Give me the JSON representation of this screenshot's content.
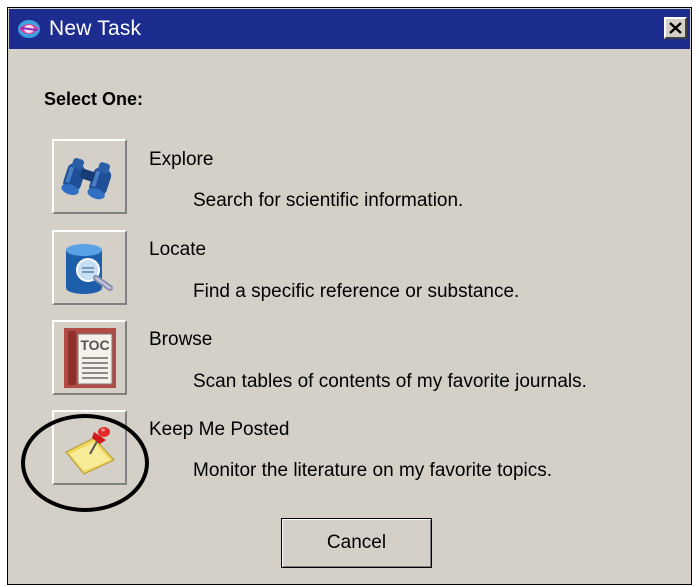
{
  "window": {
    "title": "New Task",
    "app_icon": "app-logo-icon",
    "close_icon": "close-icon",
    "title_bar_color": "#1d2d8f"
  },
  "heading": "Select One:",
  "tasks": [
    {
      "title": "Explore",
      "description": "Search for scientific information.",
      "icon": "binoculars-icon"
    },
    {
      "title": "Locate",
      "description": "Find a specific reference or substance.",
      "icon": "database-search-icon"
    },
    {
      "title": "Browse",
      "description": "Scan tables of contents of my favorite journals.",
      "icon": "toc-book-icon",
      "icon_text": "TOC"
    },
    {
      "title": "Keep Me Posted",
      "description": "Monitor the literature on my favorite topics.",
      "icon": "pushpin-note-icon"
    }
  ],
  "cancel_label": "Cancel",
  "annotation": {
    "type": "circle",
    "highlights": "Keep Me Posted",
    "color": "#000000"
  }
}
